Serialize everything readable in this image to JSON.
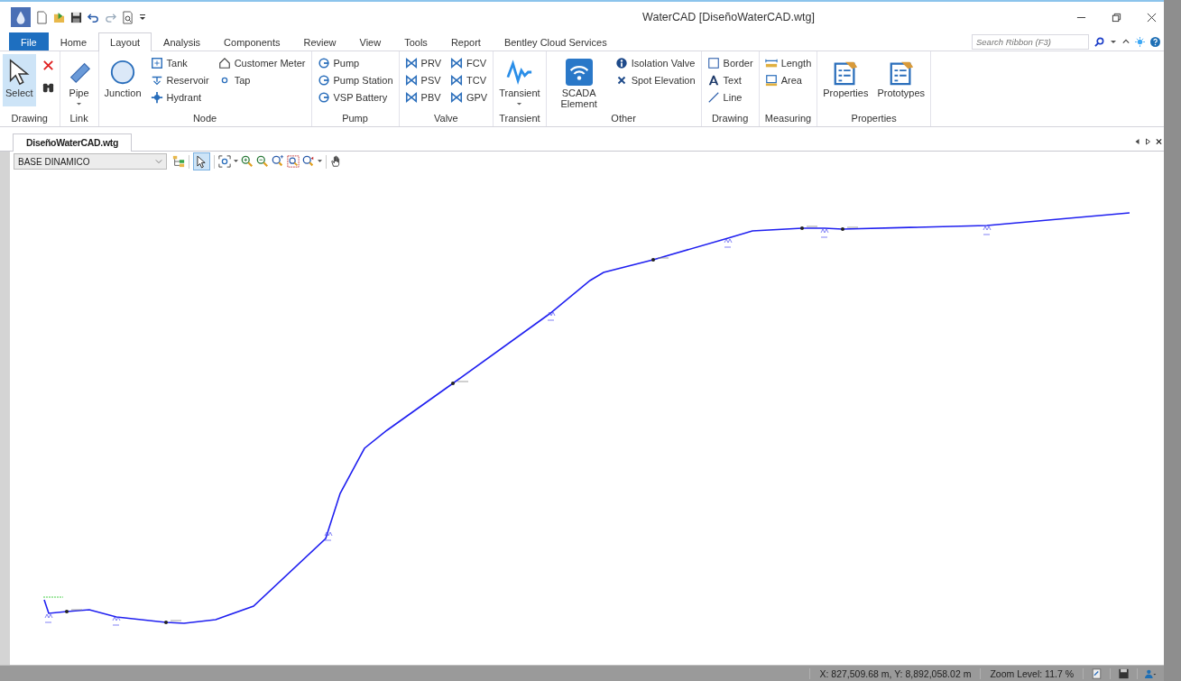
{
  "window": {
    "title": "WaterCAD [DiseñoWaterCAD.wtg]"
  },
  "menu_tabs": [
    {
      "label": "File",
      "kind": "file",
      "selected": false
    },
    {
      "label": "Home",
      "kind": "tab",
      "selected": false
    },
    {
      "label": "Layout",
      "kind": "tab",
      "selected": true
    },
    {
      "label": "Analysis",
      "kind": "tab",
      "selected": false
    },
    {
      "label": "Components",
      "kind": "tab",
      "selected": false
    },
    {
      "label": "Review",
      "kind": "tab",
      "selected": false
    },
    {
      "label": "View",
      "kind": "tab",
      "selected": false
    },
    {
      "label": "Tools",
      "kind": "tab",
      "selected": false
    },
    {
      "label": "Report",
      "kind": "tab",
      "selected": false
    },
    {
      "label": "Bentley Cloud Services",
      "kind": "tab",
      "selected": false
    }
  ],
  "search": {
    "placeholder": "Search Ribbon (F3)"
  },
  "ribbon_groups": [
    {
      "label": "Drawing",
      "columns": [
        [
          {
            "label": "Select",
            "kind": "large",
            "selected": true
          }
        ],
        [
          {
            "kind": "icon",
            "selected": false
          },
          {
            "kind": "icon",
            "selected": false
          }
        ]
      ]
    },
    {
      "label": "Link",
      "columns": [
        [
          {
            "label": "Pipe",
            "kind": "large-dropdown",
            "selected": false
          }
        ]
      ]
    },
    {
      "label": "Node",
      "columns": [
        [
          {
            "label": "Junction",
            "kind": "large",
            "selected": false
          }
        ],
        [
          {
            "label": "Tank",
            "kind": "small",
            "selected": false
          },
          {
            "label": "Reservoir",
            "kind": "small",
            "selected": false
          },
          {
            "label": "Hydrant",
            "kind": "small",
            "selected": false
          }
        ],
        [
          {
            "label": "Customer Meter",
            "kind": "small",
            "selected": false
          },
          {
            "label": "Tap",
            "kind": "small",
            "selected": false
          }
        ]
      ]
    },
    {
      "label": "Pump",
      "columns": [
        [
          {
            "label": "Pump",
            "kind": "small",
            "selected": false
          },
          {
            "label": "Pump Station",
            "kind": "small",
            "selected": false
          },
          {
            "label": "VSP Battery",
            "kind": "small",
            "selected": false
          }
        ]
      ]
    },
    {
      "label": "Valve",
      "columns": [
        [
          {
            "label": "PRV",
            "kind": "small",
            "selected": false
          },
          {
            "label": "PSV",
            "kind": "small",
            "selected": false
          },
          {
            "label": "PBV",
            "kind": "small",
            "selected": false
          }
        ],
        [
          {
            "label": "FCV",
            "kind": "small",
            "selected": false
          },
          {
            "label": "TCV",
            "kind": "small",
            "selected": false
          },
          {
            "label": "GPV",
            "kind": "small",
            "selected": false
          }
        ]
      ]
    },
    {
      "label": "Transient",
      "columns": [
        [
          {
            "label": "Transient",
            "kind": "large-dropdown",
            "selected": false
          }
        ]
      ]
    },
    {
      "label": "Other",
      "columns": [
        [
          {
            "label": "SCADA Element",
            "kind": "large",
            "selected": false
          }
        ],
        [
          {
            "label": "Isolation Valve",
            "kind": "small",
            "selected": false
          },
          {
            "label": "Spot Elevation",
            "kind": "small",
            "selected": false
          }
        ]
      ]
    },
    {
      "label": "Drawing",
      "columns": [
        [
          {
            "label": "Border",
            "kind": "small",
            "selected": false
          },
          {
            "label": "Text",
            "kind": "small",
            "selected": false
          },
          {
            "label": "Line",
            "kind": "small",
            "selected": false
          }
        ]
      ]
    },
    {
      "label": "Measuring",
      "columns": [
        [
          {
            "label": "Length",
            "kind": "small",
            "selected": false
          },
          {
            "label": "Area",
            "kind": "small",
            "selected": false
          }
        ]
      ]
    },
    {
      "label": "Properties",
      "columns": [
        [
          {
            "label": "Properties",
            "kind": "large",
            "selected": false
          }
        ],
        [
          {
            "label": "Prototypes",
            "kind": "large",
            "selected": false
          }
        ]
      ]
    }
  ],
  "document_tabs": [
    {
      "label": "DiseñoWaterCAD.wtg",
      "selected": true
    }
  ],
  "toolbar": {
    "layer": "BASE DINAMICO",
    "select_tool_active": true
  },
  "status_bar": {
    "coordinates": "X: 827,509.68 m, Y: 8,892,058.02 m",
    "zoom": "Zoom Level: 11.7 %"
  }
}
